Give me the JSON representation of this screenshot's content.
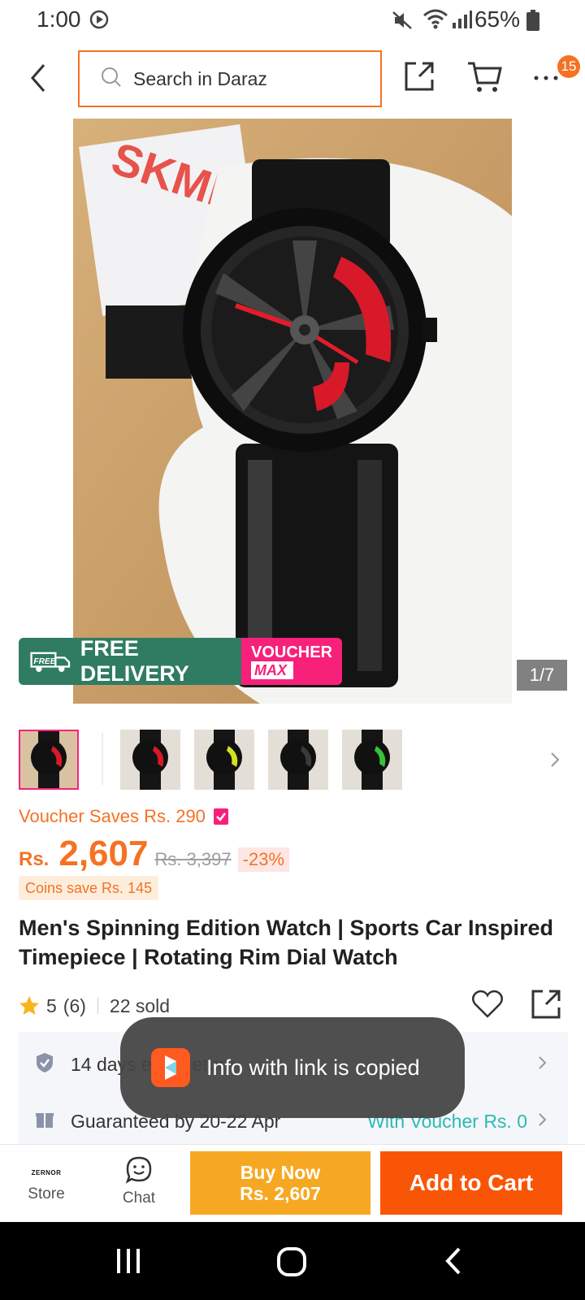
{
  "status": {
    "time": "1:00",
    "battery": "65%"
  },
  "header": {
    "search_placeholder": "Search in Daraz",
    "cart_badge": "15"
  },
  "gallery": {
    "counter": "1/7",
    "promo_free": "FREE DELIVERY",
    "promo_free_truck": "FREE",
    "promo_voucher_line1": "VOUCHER",
    "promo_voucher_line2": "MAX",
    "image_brand": "SKMEI"
  },
  "product": {
    "voucher_saves": "Voucher Saves Rs. 290",
    "currency": "Rs.",
    "price": "2,607",
    "old_price": "Rs. 3,397",
    "discount": "-23%",
    "coins": "Coins save Rs. 145",
    "title": "Men's Spinning Edition Watch | Sports Car Inspired Timepiece | Rotating Rim Dial Watch",
    "rating": "5",
    "rating_count": "(6)",
    "sold": "22 sold"
  },
  "services": {
    "returns": "14 days easy return",
    "delivery": "Guaranteed by 20-22 Apr",
    "delivery_extra": "With Voucher Rs. 0"
  },
  "toast": {
    "text": "Info with link is copied"
  },
  "bottom": {
    "store_logo": "ZERNOR",
    "store": "Store",
    "chat": "Chat",
    "buy_now_line1": "Buy Now",
    "buy_now_line2": "Rs. 2,607",
    "add_to_cart": "Add to Cart"
  },
  "colors": {
    "brand_orange": "#f57224",
    "buy_now": "#f7a823",
    "add_to_cart": "#f85606",
    "teal": "#2abbb1",
    "pink": "#f7217a"
  }
}
